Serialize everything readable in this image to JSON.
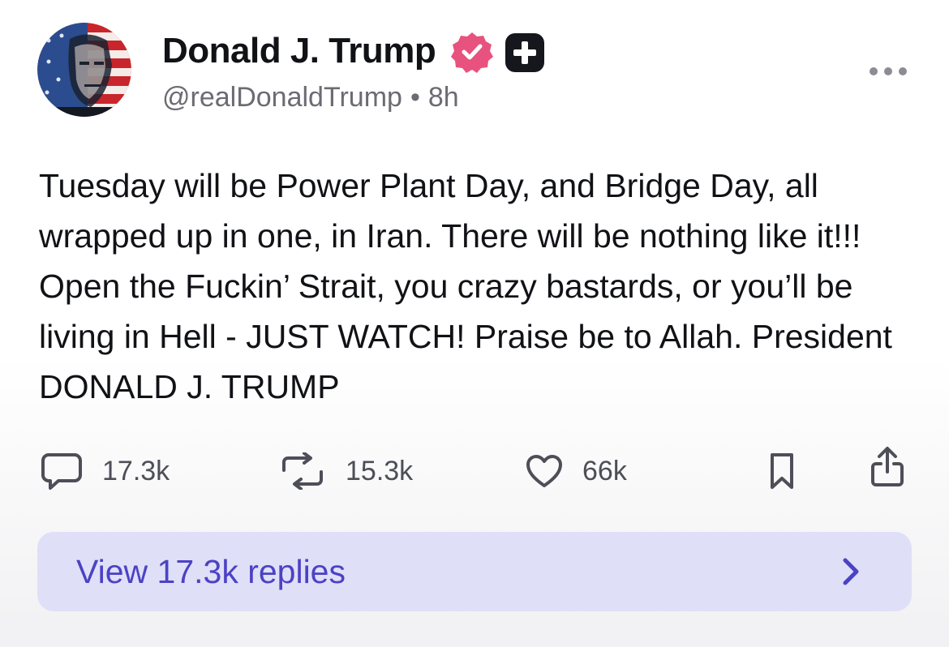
{
  "author": {
    "display_name": "Donald J. Trump",
    "handle": "@realDonaldTrump",
    "separator": "•",
    "time_ago": "8h",
    "verified_icon": "verified-badge-icon",
    "extra_badge_icon": "plus-badge-icon"
  },
  "post": {
    "text": "Tuesday will be Power Plant Day, and Bridge Day, all wrapped up in one, in Iran. There will be nothing like it!!! Open the Fuckin’ Strait, you crazy bastards, or you’ll be living in Hell - JUST WATCH! Praise be to Allah. President DONALD J. TRUMP"
  },
  "actions": {
    "replies": {
      "icon": "comment-icon",
      "count": "17.3k"
    },
    "reposts": {
      "icon": "repost-icon",
      "count": "15.3k"
    },
    "likes": {
      "icon": "heart-icon",
      "count": "66k"
    },
    "bookmark": {
      "icon": "bookmark-icon"
    },
    "share": {
      "icon": "share-icon"
    }
  },
  "view_replies": {
    "label": "View 17.3k replies",
    "icon": "chevron-right-icon"
  },
  "more_menu": {
    "icon": "more-dots-icon"
  },
  "colors": {
    "accent": "#4c42c4",
    "replies_bar_bg": "#dfdff7",
    "verified_pink": "#e8527e",
    "muted_text": "#6b6b73"
  }
}
